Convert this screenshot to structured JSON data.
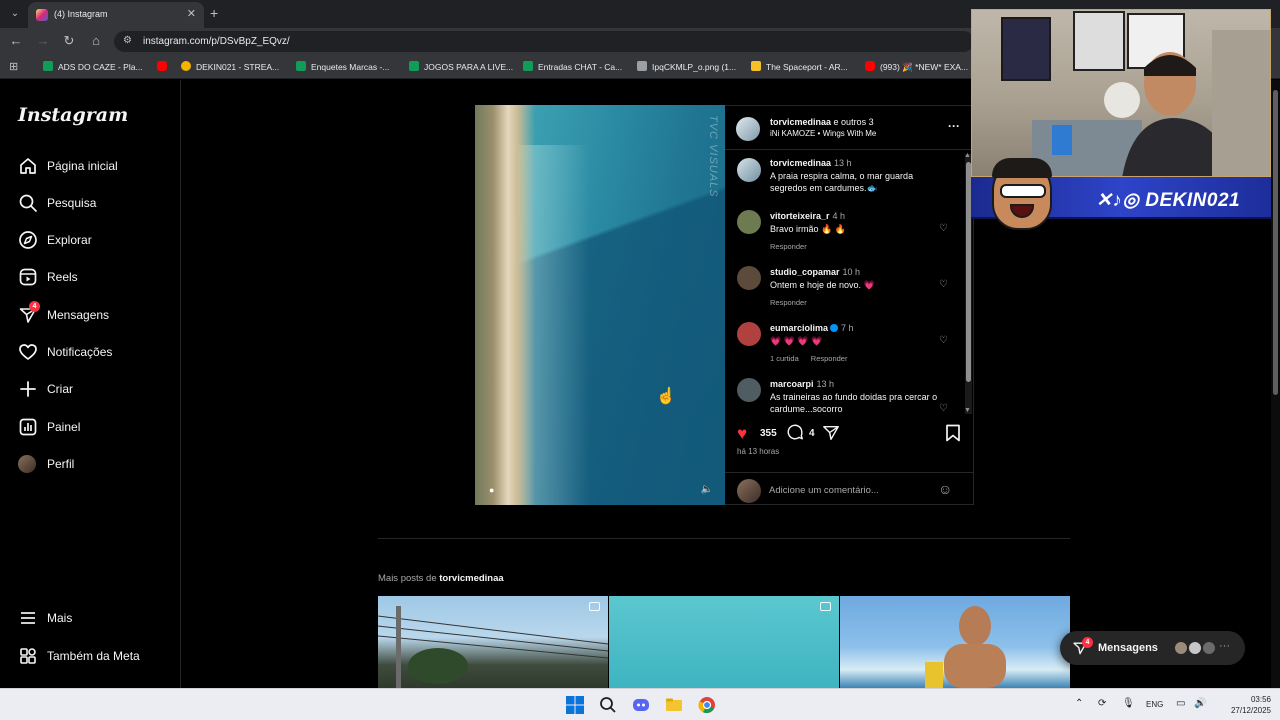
{
  "browser": {
    "tab_title": "(4) Instagram",
    "url": "instagram.com/p/DSvBpZ_EQvz/",
    "bookmarks": [
      {
        "label": "ADS DO CAZE - Pla...",
        "color": "#0f9d58"
      },
      {
        "label": "",
        "color": "#ff0000"
      },
      {
        "label": "DEKIN021 - STREA...",
        "color": "#f4b400"
      },
      {
        "label": "Enquetes Marcas -...",
        "color": "#0f9d58"
      },
      {
        "label": "JOGOS PARA A LIVE...",
        "color": "#0f9d58"
      },
      {
        "label": "Entradas CHAT - Ca...",
        "color": "#0f9d58"
      },
      {
        "label": "IpqCKMLP_o.png (1...",
        "color": "#9aa0a6"
      },
      {
        "label": "The Spaceport - AR...",
        "color": "#f6c026"
      },
      {
        "label": "(993) 🎉 *NEW* EXA...",
        "color": "#ff0000"
      }
    ]
  },
  "sidebar": {
    "logo": "Instagram",
    "items": [
      {
        "label": "Página inicial",
        "icon": "home-icon"
      },
      {
        "label": "Pesquisa",
        "icon": "search-icon"
      },
      {
        "label": "Explorar",
        "icon": "compass-icon"
      },
      {
        "label": "Reels",
        "icon": "reels-icon"
      },
      {
        "label": "Mensagens",
        "icon": "messenger-icon",
        "badge": "4"
      },
      {
        "label": "Notificações",
        "icon": "heart-icon"
      },
      {
        "label": "Criar",
        "icon": "plus-icon"
      },
      {
        "label": "Painel",
        "icon": "dashboard-icon"
      },
      {
        "label": "Perfil",
        "icon": "avatar"
      }
    ],
    "bottom": [
      {
        "label": "Mais",
        "icon": "menu-icon"
      },
      {
        "label": "Também da Meta",
        "icon": "meta-icon"
      }
    ]
  },
  "post": {
    "header_user": "torvicmedinaa",
    "header_collab": "e outros 3",
    "audio": "iNi KAMOZE • Wings With Me",
    "watermark": "TVC VISUALS",
    "comments": [
      {
        "user": "torvicmedinaa",
        "time": "13 h",
        "text": "A praia respira calma, o mar guarda segredos em cardumes.🐟",
        "meta": [],
        "avatar": "#8fa9b8"
      },
      {
        "user": "vitorteixeira_r",
        "time": "4 h",
        "text": "Bravo irmão 🔥 🔥",
        "meta": [
          "Responder"
        ],
        "avatar": "#6e7a4f"
      },
      {
        "user": "studio_copamar",
        "time": "10 h",
        "text": "Ontem e hoje de novo. 💗",
        "meta": [
          "Responder"
        ],
        "avatar": "#5c4a3a"
      },
      {
        "user": "eumarciolima",
        "time": "7 h",
        "text": "💗 💗 💗 💗",
        "meta": [
          "1 curtida",
          "Responder"
        ],
        "avatar": "#b0413e",
        "verified": true
      },
      {
        "user": "marcoarpi",
        "time": "13 h",
        "text": "As traineiras ao fundo doidas pra cercar o cardume...socorro",
        "meta": [],
        "avatar": "#4f5d63"
      }
    ],
    "likes": "355",
    "comments_count": "4",
    "time_ago": "há 13 horas",
    "comment_placeholder": "Adicione um comentário..."
  },
  "more_posts": {
    "prefix": "Mais posts de",
    "user": "torvicmedinaa"
  },
  "webcam": {
    "handle": "DEKIN021"
  },
  "messages_pill": {
    "label": "Mensagens",
    "badge": "4"
  },
  "taskbar": {
    "lang": "ENG",
    "time": "03:56",
    "date": "27/12/2025"
  }
}
